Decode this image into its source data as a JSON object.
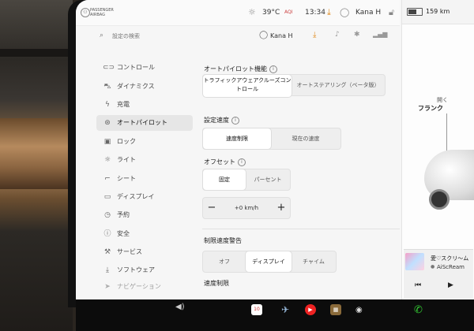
{
  "status": {
    "airbag_line1": "PASSENGER",
    "airbag_line2": "AIRBAG",
    "temperature": "39°C",
    "aqi": "AQI",
    "time": "13:34",
    "user": "Kana H"
  },
  "right_panel": {
    "range": "159 km",
    "frunk_open": "開く",
    "frunk": "フランク",
    "media_title": "愛♡スクリ〜ム",
    "media_artist": "AiScReam"
  },
  "search": {
    "placeholder": "設定の検索",
    "user": "Kana H"
  },
  "sidebar": {
    "items": [
      {
        "label": "コントロール",
        "icon": "toggle-icon"
      },
      {
        "label": "ダイナミクス",
        "icon": "car-icon"
      },
      {
        "label": "充電",
        "icon": "bolt-icon"
      },
      {
        "label": "オートパイロット",
        "icon": "steering-wheel-icon"
      },
      {
        "label": "ロック",
        "icon": "lock-icon"
      },
      {
        "label": "ライト",
        "icon": "sun-icon"
      },
      {
        "label": "シート",
        "icon": "seat-icon"
      },
      {
        "label": "ディスプレイ",
        "icon": "display-icon"
      },
      {
        "label": "予約",
        "icon": "clock-icon"
      },
      {
        "label": "安全",
        "icon": "info-icon"
      },
      {
        "label": "サービス",
        "icon": "wrench-icon"
      },
      {
        "label": "ソフトウェア",
        "icon": "download-icon"
      },
      {
        "label": "ナビゲーション",
        "icon": "navigation-icon"
      }
    ]
  },
  "autopilot": {
    "feature_title": "オートパイロット機能",
    "feature_options": [
      "トラフィックアウェアクルーズコントロール",
      "オートステアリング（ベータ版）"
    ],
    "speed_title": "設定速度",
    "speed_options": [
      "速度制限",
      "現在の速度"
    ],
    "offset_title": "オフセット",
    "offset_options": [
      "固定",
      "パーセント"
    ],
    "offset_value": "+0 km/h",
    "warning_title": "制限速度警告",
    "warning_options": [
      "オフ",
      "ディスプレイ",
      "チャイム"
    ],
    "limit_title": "速度制限"
  },
  "colors": {
    "accent_download": "#e08a1e",
    "active_bg": "#e6e6e6"
  }
}
